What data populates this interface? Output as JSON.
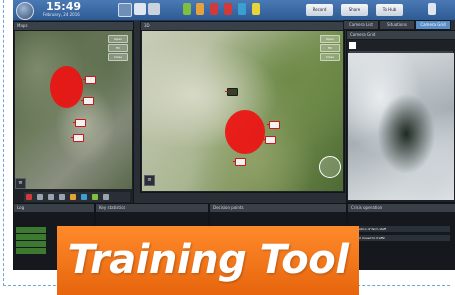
{
  "topbar": {
    "time": "15:49",
    "date": "February, 24 2016",
    "buttons": [
      {
        "label": "Record"
      },
      {
        "label": "Share"
      },
      {
        "label": "To Hub"
      }
    ]
  },
  "tabs_right": [
    {
      "label": "Camera List",
      "active": false
    },
    {
      "label": "Situations",
      "active": false
    },
    {
      "label": "Camera Grid",
      "active": true
    }
  ],
  "panels": {
    "maps_title": "Maps",
    "center_title": "3D",
    "camera_title": "Camera Grid",
    "map_buttons": [
      "Open",
      "Fill",
      "Close"
    ],
    "log_title": "Log",
    "key_stats_title": "Key statistics",
    "decision_title": "Decision points",
    "crisis_title": "Crisis operation"
  },
  "crisis_items": [
    "Evacuation of farm staff",
    "Control closed to traffic"
  ],
  "banner": {
    "text": "Training Tool"
  },
  "colors": {
    "accent": "#5a8ec9",
    "zone": "#ee1111",
    "banner": "#ef7417"
  }
}
